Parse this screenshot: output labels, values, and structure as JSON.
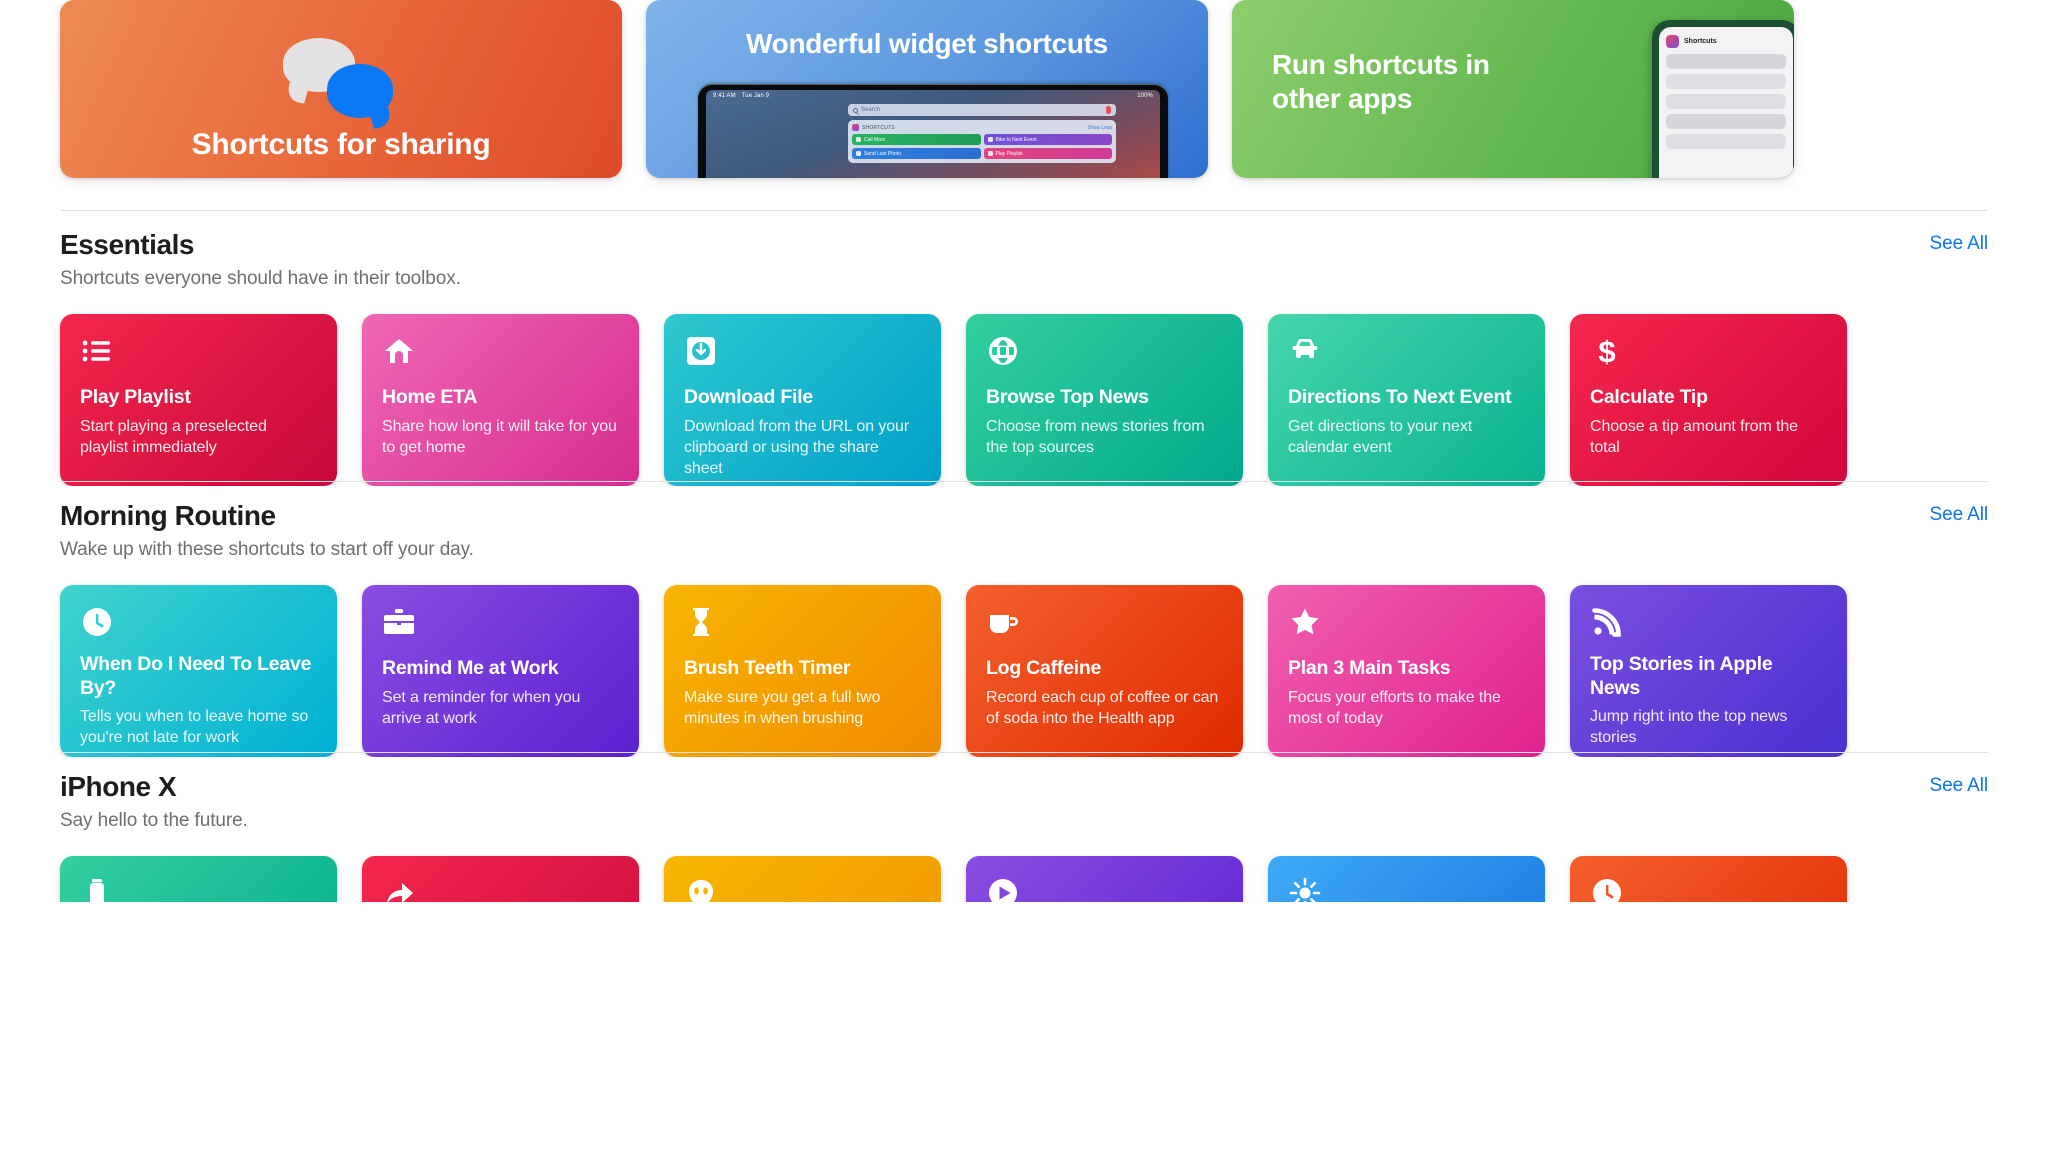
{
  "banners": [
    {
      "id": "shortcuts-for-sharing",
      "title": "Shortcuts for sharing",
      "art": "speech-bubbles"
    },
    {
      "id": "wonderful-widget-shortcuts",
      "title": "Wonderful widget shortcuts",
      "art": "ipad-widget",
      "device": {
        "status_time": "9:41 AM",
        "status_date": "Tue Jan 9",
        "status_battery": "100%",
        "search_placeholder": "Search",
        "widget_title": "SHORTCUTS",
        "widget_action": "Show Less",
        "tiles": [
          "Call Mom",
          "Bike to Next Event",
          "Send Last Photo",
          "Play Playlist"
        ]
      }
    },
    {
      "id": "run-shortcuts-in-other-apps",
      "title": "Run shortcuts in other apps",
      "art": "iphone-mock",
      "device": {
        "app_label": "Shortcuts"
      }
    }
  ],
  "sections": [
    {
      "id": "essentials",
      "title": "Essentials",
      "subtitle": "Shortcuts everyone should have in their toolbox.",
      "see_all": "See All",
      "cards": [
        {
          "title": "Play Playlist",
          "desc": "Start playing a preselected playlist immediately",
          "icon": "list-icon",
          "color_from": "#f4274d",
          "color_to": "#c8083a"
        },
        {
          "title": "Home ETA",
          "desc": "Share how long it will take for you to get home",
          "icon": "home-icon",
          "color_from": "#f067b4",
          "color_to": "#d62d8f"
        },
        {
          "title": "Download File",
          "desc": "Download from the URL on your clipboard or using the share sheet",
          "icon": "download-square-icon",
          "color_from": "#2ec9cf",
          "color_to": "#009fc9"
        },
        {
          "title": "Browse Top News",
          "desc": "Choose from news stories from the top sources",
          "icon": "globe-icon",
          "color_from": "#34cfa0",
          "color_to": "#00a98a"
        },
        {
          "title": "Directions To Next Event",
          "desc": "Get directions to your next calendar event",
          "icon": "car-icon",
          "color_from": "#45d5ad",
          "color_to": "#09b38f"
        },
        {
          "title": "Calculate Tip",
          "desc": "Choose a tip amount from the total",
          "icon": "dollar-icon",
          "color_from": "#f4274d",
          "color_to": "#d2063c"
        }
      ]
    },
    {
      "id": "morning-routine",
      "title": "Morning Routine",
      "subtitle": "Wake up with these shortcuts to start off your day.",
      "see_all": "See All",
      "cards": [
        {
          "title": "When Do I Need To Leave By?",
          "desc": "Tells you when to leave home so you're not late for work",
          "icon": "clock-icon",
          "color_from": "#3fd3cd",
          "color_to": "#00b0d4"
        },
        {
          "title": "Remind Me at Work",
          "desc": "Set a reminder for when you arrive at work",
          "icon": "briefcase-icon",
          "color_from": "#8a4de2",
          "color_to": "#5a21d0"
        },
        {
          "title": "Brush Teeth Timer",
          "desc": "Make sure you get a full two minutes in when brushing",
          "icon": "hourglass-icon",
          "color_from": "#f7b500",
          "color_to": "#f08a00"
        },
        {
          "title": "Log Caffeine",
          "desc": "Record each cup of coffee or can of soda into the Health app",
          "icon": "coffee-cup-icon",
          "color_from": "#f4602c",
          "color_to": "#e02a00"
        },
        {
          "title": "Plan 3 Main Tasks",
          "desc": "Focus your efforts to make the most of today",
          "icon": "star-icon",
          "color_from": "#f05fae",
          "color_to": "#e0228e"
        },
        {
          "title": "Top Stories in Apple News",
          "desc": "Jump right into the top news stories",
          "icon": "rss-icon",
          "color_from": "#7a4fe0",
          "color_to": "#4a2fd0"
        }
      ]
    },
    {
      "id": "iphone-x",
      "title": "iPhone X",
      "subtitle": "Say hello to the future.",
      "see_all": "See All",
      "cards": [
        {
          "title": "",
          "desc": "",
          "icon": "battery-icon",
          "color_from": "#34cfa0",
          "color_to": "#00ab8c"
        },
        {
          "title": "",
          "desc": "",
          "icon": "share-icon",
          "color_from": "#f4274d",
          "color_to": "#cc0a3e"
        },
        {
          "title": "",
          "desc": "",
          "icon": "animoji-icon",
          "color_from": "#f7b500",
          "color_to": "#f09500"
        },
        {
          "title": "",
          "desc": "",
          "icon": "play-icon",
          "color_from": "#8a4de2",
          "color_to": "#5a21d0"
        },
        {
          "title": "",
          "desc": "",
          "icon": "sparkle-icon",
          "color_from": "#3fa9f5",
          "color_to": "#1474e0"
        },
        {
          "title": "",
          "desc": "",
          "icon": "clock2-icon",
          "color_from": "#f4602c",
          "color_to": "#e02a00"
        }
      ]
    }
  ]
}
